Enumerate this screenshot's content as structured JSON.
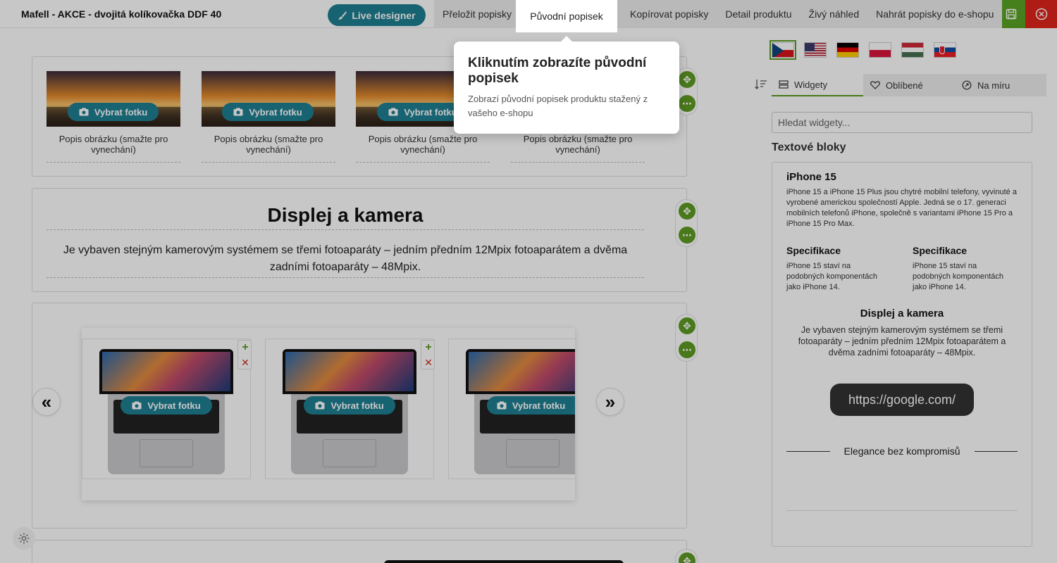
{
  "header": {
    "product_title": "Mafell - AKCE - dvojitá kolíkovačka DDF 40",
    "live_designer": "Live designer",
    "nav": [
      "Přeložit popisky",
      "Původní popisek",
      "Kopírovat popisky",
      "Detail produktu",
      "Živý náhled",
      "Nahrát popisky do e-shopu"
    ]
  },
  "tooltip": {
    "title": "Kliknutím zobrazíte původní popisek",
    "description": "Zobrazí původní popisek produktu stažený z vašeho e-shopu"
  },
  "editor": {
    "choose_photo": "Vybrat fotku",
    "image_caption": "Popis obrázku (smažte pro vynechání)",
    "text_block": {
      "heading": "Displej a kamera",
      "paragraph": "Je vybaven stejným kamerovým systémem se třemi fotoaparáty – jedním předním 12Mpix fotoaparátem a dvěma zadními fotoaparáty – 48Mpix."
    },
    "carousel": {
      "prev": "«",
      "next": "»"
    }
  },
  "sidebar": {
    "languages": [
      "cs",
      "en",
      "de",
      "pl",
      "hu",
      "sk"
    ],
    "tabs": [
      "Widgety",
      "Oblíbené",
      "Na míru"
    ],
    "search_placeholder": "Hledat widgety...",
    "section_title": "Textové bloky",
    "preview": {
      "title": "iPhone 15",
      "intro": "iPhone 15 a iPhone 15 Plus jsou chytré mobilní telefony, vyvinuté a vyrobené americkou společností Apple. Jedná se o 17. generaci mobilních telefonů iPhone, společně s variantami iPhone 15 Pro a iPhone 15 Pro Max.",
      "spec_left_title": "Specifikace",
      "spec_left_text": "iPhone 15 staví na podobných komponentách jako iPhone 14.",
      "spec_right_title": "Specifikace",
      "spec_right_text": "iPhone 15 staví na podobných komponentách jako iPhone 14.",
      "display_title": "Displej a kamera",
      "display_text": "Je vybaven stejným kamerovým systémem se třemi fotoaparáty – jedním předním 12Mpix fotoaparátem a dvěma zadními fotoaparáty – 48Mpix.",
      "url_button": "https://google.com/",
      "divider_title": "Elegance bez kompromisů"
    }
  },
  "colors": {
    "accent_teal": "#1f7f93",
    "accent_green": "#5e9b22",
    "danger_red": "#e0241b"
  }
}
